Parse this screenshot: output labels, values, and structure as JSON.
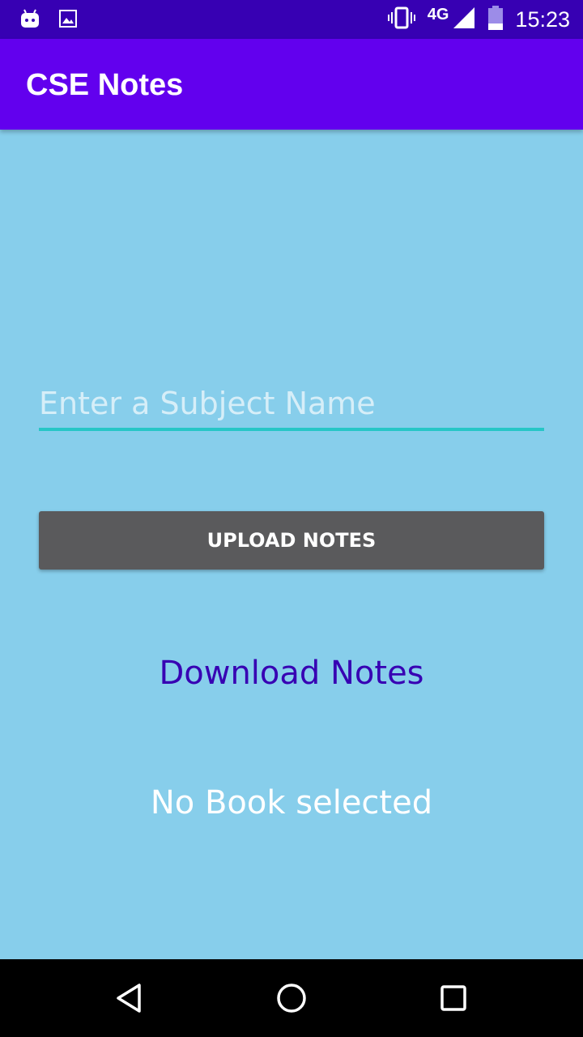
{
  "status_bar": {
    "network": "4G",
    "time": "15:23",
    "icons": [
      "android-notification-icon",
      "image-notification-icon",
      "vibrate-icon",
      "signal-icon",
      "battery-icon"
    ]
  },
  "app_bar": {
    "title": "CSE Notes"
  },
  "form": {
    "subject_value": "",
    "subject_placeholder": "Enter a Subject Name",
    "upload_label": "UPLOAD NOTES",
    "download_label": "Download Notes",
    "status_text": "No Book selected"
  },
  "nav_bar": {
    "icons": [
      "back-icon",
      "home-icon",
      "recents-icon"
    ]
  },
  "colors": {
    "status_bar": "#3700B3",
    "app_bar": "#6200EE",
    "background": "#87CEEB",
    "input_underline": "#26C6C6",
    "button": "#5A5A5C",
    "link": "#3700B3"
  }
}
